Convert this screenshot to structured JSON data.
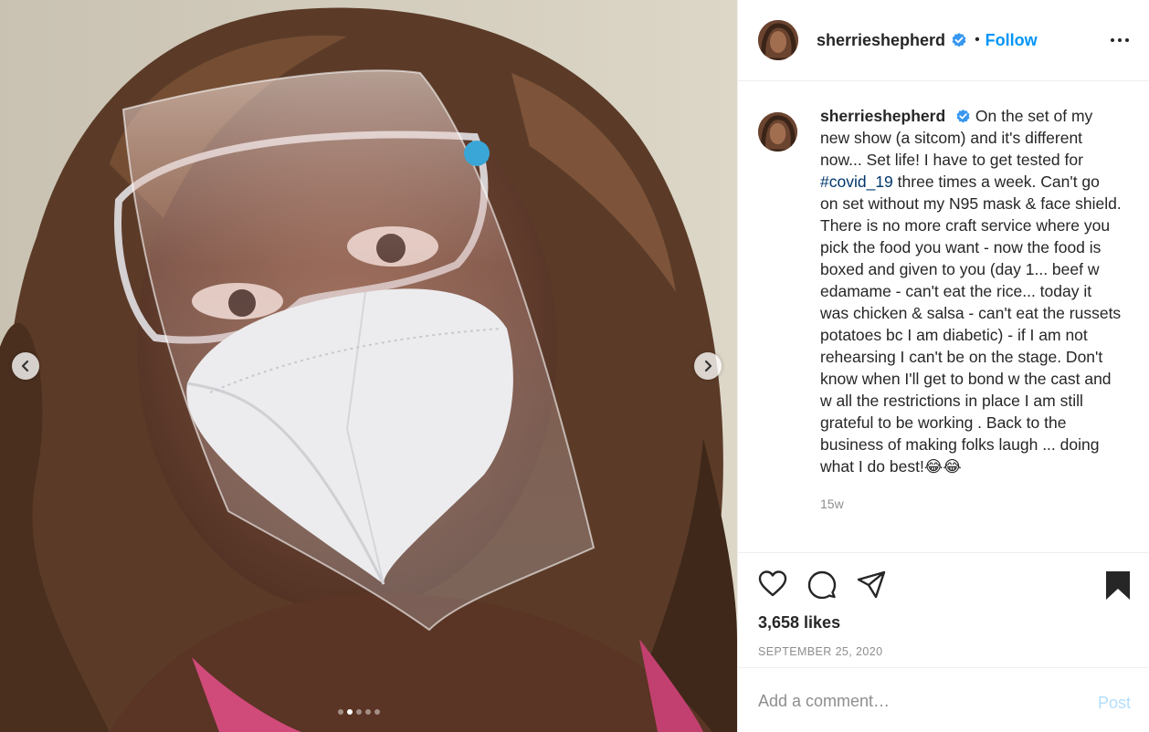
{
  "post": {
    "username": "sherrieshepherd",
    "separator": "•",
    "follow_label": "Follow",
    "more_icon": "more-options-icon",
    "verified_icon": "verified-badge-icon"
  },
  "caption": {
    "username": "sherrieshepherd",
    "text_before": "On the set of my new show (a sitcom) and it's different now... Set life! I have to get tested for ",
    "hashtag": "#covid_19",
    "text_after": " three times a week. Can't go on set without my N95 mask & face shield. There is no more craft service where you pick the food you want - now the food is boxed and given to you (day 1... beef w edamame - can't eat the rice... today it was chicken & salsa - can't eat the russets potatoes bc I am diabetic) - if I am not rehearsing I can't be on the stage. Don't know when I'll get to bond w the cast and w all the restrictions in place I am still grateful to be working . Back to the business of making folks laugh ... doing what I do best!😂😂",
    "time": "15w"
  },
  "actions": {
    "like_icon": "heart-icon",
    "comment_icon": "comment-icon",
    "share_icon": "share-icon",
    "save_icon": "bookmark-icon",
    "likes": "3,658 likes",
    "date": "SEPTEMBER 25, 2020"
  },
  "comment": {
    "placeholder": "Add a comment…",
    "post_label": "Post"
  },
  "carousel": {
    "total_slides": 5,
    "active_slide": 2,
    "prev_icon": "chevron-left-icon",
    "next_icon": "chevron-right-icon"
  },
  "colors": {
    "accent": "#0095f6",
    "post_disabled": "#b2dffc",
    "hashtag": "#00376b",
    "muted": "#8e8e8e"
  }
}
